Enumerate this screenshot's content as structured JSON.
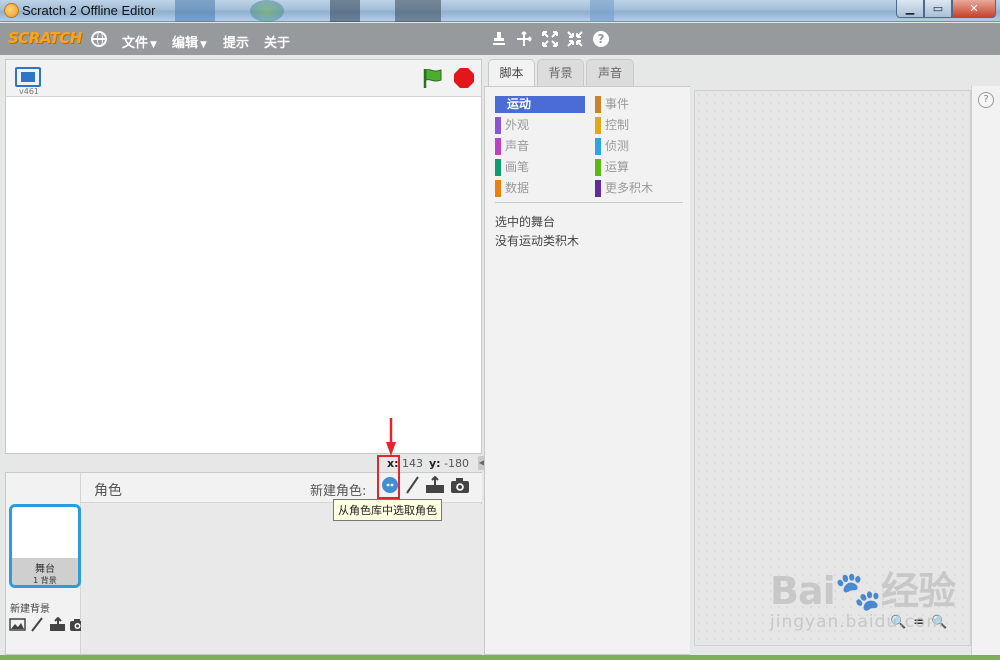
{
  "window": {
    "title": "Scratch 2 Offline Editor"
  },
  "menubar": {
    "logo_text": "SCRATCH",
    "items": [
      {
        "label": "文件",
        "has_caret": true
      },
      {
        "label": "编辑",
        "has_caret": true
      },
      {
        "label": "提示",
        "has_caret": false
      },
      {
        "label": "关于",
        "has_caret": false
      }
    ],
    "caret": "▼",
    "tools": [
      "stamp-icon",
      "cut-icon",
      "grow-icon",
      "shrink-icon",
      "help-icon"
    ]
  },
  "stage": {
    "version": "v461",
    "coords": {
      "x_label": "x:",
      "x_value": "143",
      "y_label": "y:",
      "y_value": "-180"
    }
  },
  "sprites": {
    "header_label": "角色",
    "new_sprite_label": "新建角色:",
    "tooltip": "从角色库中选取角色",
    "stage_thumb": {
      "name": "舞台",
      "subtitle": "1 背景"
    },
    "new_backdrop_label": "新建背景"
  },
  "tabs": [
    {
      "label": "脚本",
      "active": true
    },
    {
      "label": "背景",
      "active": false
    },
    {
      "label": "声音",
      "active": false
    }
  ],
  "palette": {
    "categories": [
      {
        "label": "运动",
        "color": "#4a6cd4",
        "active": true
      },
      {
        "label": "外观",
        "color": "#8a55d7",
        "active": false
      },
      {
        "label": "声音",
        "color": "#bb42c3",
        "active": false
      },
      {
        "label": "画笔",
        "color": "#0e9a6c",
        "active": false
      },
      {
        "label": "数据",
        "color": "#ee7d16",
        "active": false
      },
      {
        "label": "事件",
        "color": "#c88330",
        "active": false
      },
      {
        "label": "控制",
        "color": "#e1a91a",
        "active": false
      },
      {
        "label": "侦测",
        "color": "#2ca5e2",
        "active": false
      },
      {
        "label": "运算",
        "color": "#5cb712",
        "active": false
      },
      {
        "label": "更多积木",
        "color": "#632d99",
        "active": false
      }
    ],
    "message_line1": "选中的舞台",
    "message_line2": "没有运动类积木"
  },
  "script_area": {
    "help": "?",
    "zoom": [
      "🔍",
      "=",
      "🔍"
    ]
  },
  "watermark": {
    "brand": "Bai🐾经验",
    "sub": "jingyan.baidu.com"
  },
  "colors": {
    "accent_blue": "#2c9ddb",
    "menubar_gray": "#979a9d",
    "highlight_red": "#e3262e"
  }
}
